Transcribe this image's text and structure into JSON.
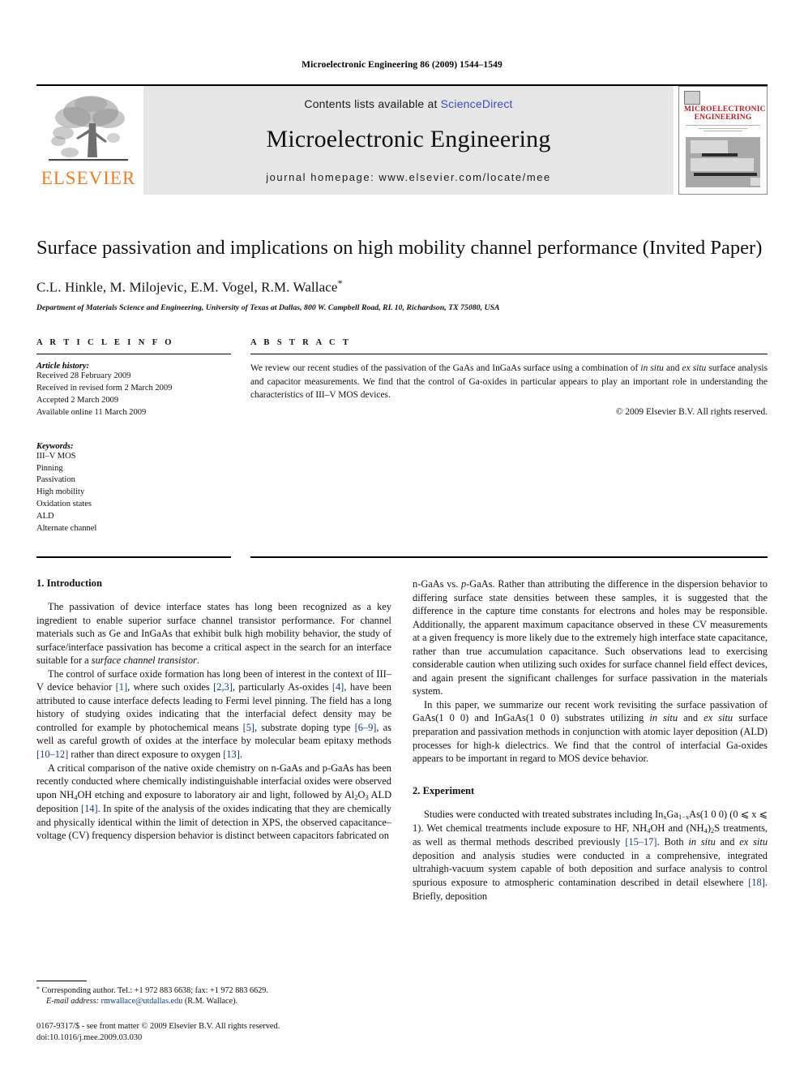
{
  "running_head": "Microelectronic Engineering 86 (2009) 1544–1549",
  "masthead": {
    "contents_prefix": "Contents lists available at ",
    "sciencedirect": "ScienceDirect",
    "journal_title": "Microelectronic Engineering",
    "homepage": "journal homepage: www.elsevier.com/locate/mee",
    "publisher_name": "ELSEVIER",
    "cover_title_line1": "MICROELECTRONIC",
    "cover_title_line2": "ENGINEERING",
    "accent_orange": "#F47B20",
    "link_blue": "#3b4cc0",
    "cite_blue": "#143a8c",
    "band_grey": "#e6e6e6"
  },
  "title": "Surface passivation and implications on high mobility channel performance (Invited Paper)",
  "authors": "C.L. Hinkle, M. Milojevic, E.M. Vogel, R.M. Wallace",
  "authors_star": "*",
  "affiliation": "Department of Materials Science and Engineering, University of Texas at Dallas, 800 W. Campbell Road, RL 10, Richardson, TX 75080, USA",
  "article_info": {
    "heading": "A R T I C L E   I N F O",
    "history_label": "Article history:",
    "history": [
      "Received 28 February 2009",
      "Received in revised form 2 March 2009",
      "Accepted 2 March 2009",
      "Available online 11 March 2009"
    ],
    "keywords_label": "Keywords:",
    "keywords": [
      "III–V MOS",
      "Pinning",
      "Passivation",
      "High mobility",
      "Oxidation states",
      "ALD",
      "Alternate channel"
    ]
  },
  "abstract": {
    "heading": "A B S T R A C T",
    "text_part1": "We review our recent studies of the passivation of the GaAs and InGaAs surface using a combination of ",
    "text_italic1": "in situ",
    "text_part2": " and ",
    "text_italic2": "ex situ",
    "text_part3": " surface analysis and capacitor measurements. We find that the control of Ga-oxides in particular appears to play an important role in understanding the characteristics of III–V MOS devices.",
    "copyright": "© 2009 Elsevier B.V. All rights reserved."
  },
  "sections": {
    "intro_title": "1. Introduction",
    "intro_p1": "The passivation of device interface states has long been recognized as a key ingredient to enable superior surface channel transistor performance. For channel materials such as Ge and InGaAs that exhibit bulk high mobility behavior, the study of surface/interface passivation has become a critical aspect in the search for an interface suitable for a ",
    "intro_p1_italic": "surface channel transistor",
    "intro_p1_end": ".",
    "intro_p2_a": "The control of surface oxide formation has long been of interest in the context of III–V device behavior ",
    "intro_p2_c1": "[1]",
    "intro_p2_b": ", where such oxides ",
    "intro_p2_c2": "[2,3]",
    "intro_p2_c": ", particularly As-oxides ",
    "intro_p2_c3": "[4]",
    "intro_p2_d": ", have been attributed to cause interface defects leading to Fermi level pinning. The field has a long history of studying oxides indicating that the interfacial defect density may be controlled for example by photochemical means ",
    "intro_p2_c4": "[5]",
    "intro_p2_e": ", substrate doping type ",
    "intro_p2_c5": "[6–9]",
    "intro_p2_f": ", as well as careful growth of oxides at the interface by molecular beam epitaxy methods ",
    "intro_p2_c6": "[10–12]",
    "intro_p2_g": " rather than direct exposure to oxygen ",
    "intro_p2_c7": "[13]",
    "intro_p2_h": ".",
    "intro_p3_a": "A critical comparison of the native oxide chemistry on n-GaAs and p-GaAs has been recently conducted where chemically indistinguishable interfacial oxides were observed upon NH",
    "intro_p3_sub1": "4",
    "intro_p3_b": "OH etching and exposure to laboratory air and light, followed by Al",
    "intro_p3_sub2": "2",
    "intro_p3_c": "O",
    "intro_p3_sub3": "3",
    "intro_p3_d": " ALD deposition ",
    "intro_p3_c1": "[14]",
    "intro_p3_e": ". In spite of the analysis of the oxides indicating that they are chemically and physically identical within the limit of detection in XPS, the observed capacitance–voltage (CV) frequency dispersion behavior is distinct between capacitors fabricated on",
    "right_p1_a": "n-GaAs vs. ",
    "right_p1_italic": "p",
    "right_p1_b": "-GaAs. Rather than attributing the difference in the dispersion behavior to differing surface state densities between these samples, it is suggested that the difference in the capture time constants for electrons and holes may be responsible. Additionally, the apparent maximum capacitance observed in these CV measurements at a given frequency is more likely due to the extremely high interface state capacitance, rather than true accumulation capacitance. Such observations lead to exercising considerable caution when utilizing such oxides for surface channel field effect devices, and again present the significant challenges for surface passivation in the materials system.",
    "right_p2_a": "In this paper, we summarize our recent work revisiting the surface passivation of GaAs(1 0 0) and InGaAs(1 0 0) substrates utilizing ",
    "right_p2_it1": "in situ",
    "right_p2_b": " and ",
    "right_p2_it2": "ex situ",
    "right_p2_c": " surface preparation and passivation methods in conjunction with atomic layer deposition (ALD) processes for high-k dielectrics. We find that the control of interfacial Ga-oxides appears to be important in regard to MOS device behavior.",
    "experiment_title": "2. Experiment",
    "exp_p1_a": "Studies were conducted with treated substrates including In",
    "exp_sub_x": "x",
    "exp_p1_b": "Ga",
    "exp_sub_1x": "1−x",
    "exp_p1_c": "As(1 0 0) (0 ⩽ x ⩽ 1). Wet chemical treatments include exposure to HF, NH",
    "exp_sub_4a": "4",
    "exp_p1_d": "OH and (NH",
    "exp_sub_4b": "4",
    "exp_p1_e": ")",
    "exp_sub_2": "2",
    "exp_p1_f": "S treatments, as well as thermal methods described previously ",
    "exp_c1": "[15–17]",
    "exp_p1_g": ". Both ",
    "exp_it1": "in situ",
    "exp_p1_h": " and ",
    "exp_it2": "ex situ",
    "exp_p1_i": " deposition and analysis studies were conducted in a comprehensive, integrated ultrahigh-vacuum system capable of both deposition and surface analysis to control spurious exposure to atmospheric contamination described in detail elsewhere ",
    "exp_c2": "[18]",
    "exp_p1_j": ". Briefly, deposition"
  },
  "footnote": {
    "bullet": "*",
    "corr_text": " Corresponding author. Tel.: +1 972 883 6638; fax: +1 972 883 6629.",
    "email_label": "E-mail address:",
    "email": "rmwallace@utdallas.edu",
    "email_suffix": " (R.M. Wallace).",
    "issn_line": "0167-9317/$ - see front matter © 2009 Elsevier B.V. All rights reserved.",
    "doi_line": "doi:10.1016/j.mee.2009.03.030"
  }
}
